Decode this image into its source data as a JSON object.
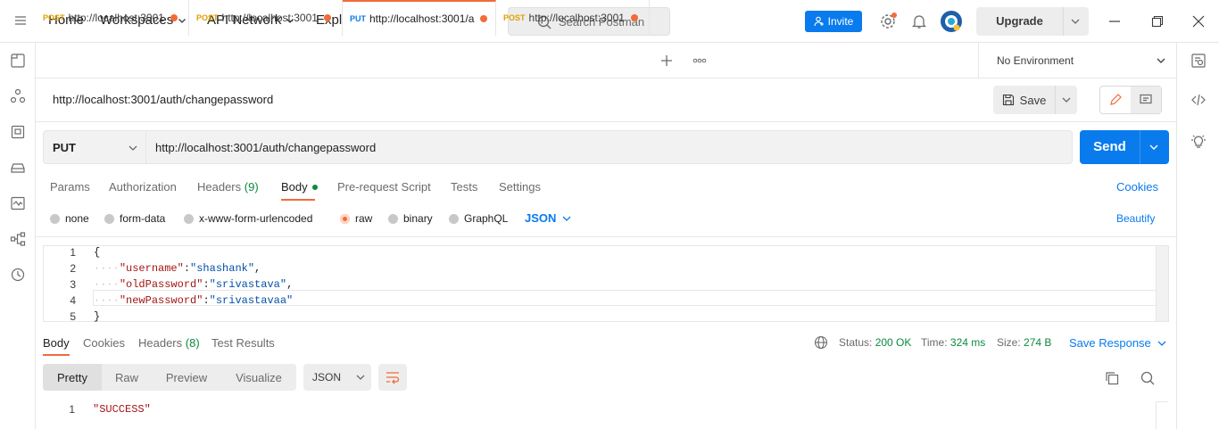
{
  "topbar": {
    "nav": [
      "Home",
      "Workspaces",
      "API Network",
      "Explore"
    ],
    "search_placeholder": "Search Postman",
    "invite_label": "Invite",
    "upgrade_label": "Upgrade"
  },
  "tabs": [
    {
      "method": "POST",
      "url": "http://localhost:3001",
      "method_color": "#e0a000"
    },
    {
      "method": "POST",
      "url": "http://localhost:3001",
      "method_color": "#e0a000"
    },
    {
      "method": "PUT",
      "url": "http://localhost:3001/a",
      "method_color": "#097bed"
    },
    {
      "method": "POST",
      "url": "http://localhost:3001",
      "method_color": "#e0a000"
    }
  ],
  "environment": "No Environment",
  "request": {
    "title": "http://localhost:3001/auth/changepassword",
    "save_label": "Save",
    "method": "PUT",
    "url": "http://localhost:3001/auth/changepassword",
    "send_label": "Send",
    "subtabs": {
      "params": "Params",
      "authorization": "Authorization",
      "headers": "Headers",
      "headers_count": "(9)",
      "body": "Body",
      "prerequest": "Pre-request Script",
      "tests": "Tests",
      "settings": "Settings"
    },
    "cookies_label": "Cookies",
    "body_types": [
      "none",
      "form-data",
      "x-www-form-urlencoded",
      "raw",
      "binary",
      "GraphQL"
    ],
    "selected_body_type": "raw",
    "format": "JSON",
    "beautify_label": "Beautify",
    "body_lines": {
      "l1": "{",
      "username_key": "\"username\"",
      "username_val": "\"shashank\"",
      "oldpassword_key": "\"oldPassword\"",
      "oldpassword_val": "\"srivastava\"",
      "newpassword_key": "\"newPassword\"",
      "newpassword_val": "\"srivastavaa\"",
      "l5": "}"
    },
    "line_numbers": [
      "1",
      "2",
      "3",
      "4",
      "5"
    ]
  },
  "response": {
    "tabs": {
      "body": "Body",
      "cookies": "Cookies",
      "headers": "Headers",
      "headers_count": "(8)",
      "tests": "Test Results"
    },
    "status_label": "Status:",
    "status_value": "200 OK",
    "time_label": "Time:",
    "time_value": "324 ms",
    "size_label": "Size:",
    "size_value": "274 B",
    "save_response_label": "Save Response",
    "view_modes": [
      "Pretty",
      "Raw",
      "Preview",
      "Visualize"
    ],
    "format": "JSON",
    "line_number": "1",
    "body": "\"SUCCESS\""
  },
  "colors": {
    "accent": "#f26b3a",
    "primary": "#097bed",
    "success": "#0c8a3e"
  }
}
